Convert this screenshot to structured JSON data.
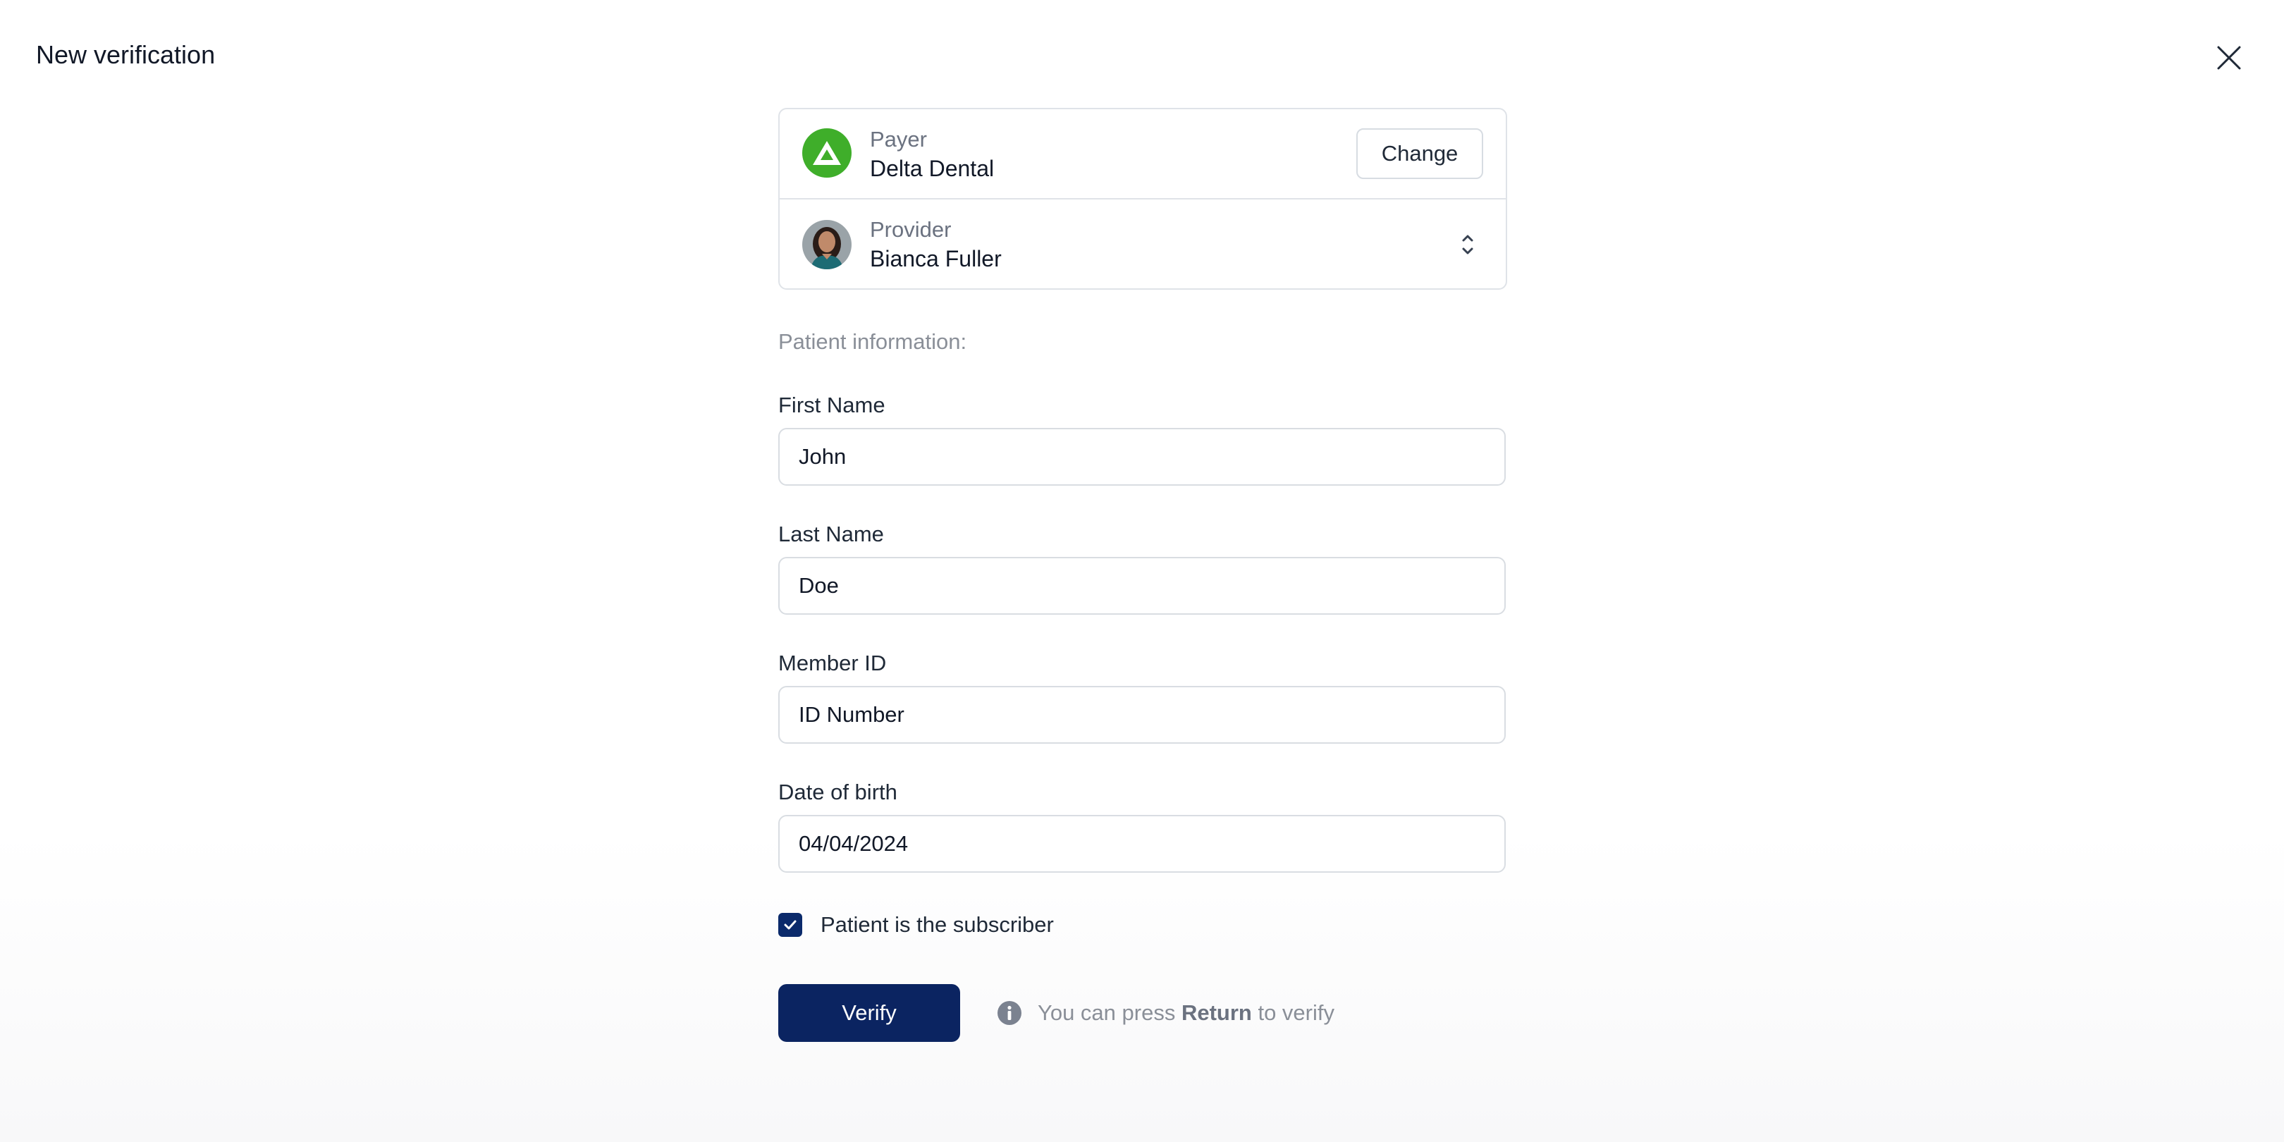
{
  "header": {
    "title": "New verification",
    "close_icon": "close-icon"
  },
  "payer": {
    "caption": "Payer",
    "name": "Delta Dental",
    "change_label": "Change",
    "logo_color": "#3fae2a"
  },
  "provider": {
    "caption": "Provider",
    "name": "Bianca Fuller"
  },
  "patient": {
    "section_label": "Patient information:",
    "first_name": {
      "label": "First Name",
      "value": "John"
    },
    "last_name": {
      "label": "Last Name",
      "value": "Doe"
    },
    "member_id": {
      "label": "Member ID",
      "placeholder": "ID Number"
    },
    "dob": {
      "label": "Date of birth",
      "value": "04/04/2024"
    },
    "subscriber": {
      "label": "Patient is the subscriber",
      "checked": true
    }
  },
  "actions": {
    "verify_label": "Verify",
    "hint_prefix": "You can press",
    "hint_key": "Return",
    "hint_suffix": "to verify"
  },
  "colors": {
    "primary": "#0b2461",
    "checkbox": "#0b2a6b",
    "muted_text": "#8a8f98",
    "border": "#dfe3e8"
  }
}
